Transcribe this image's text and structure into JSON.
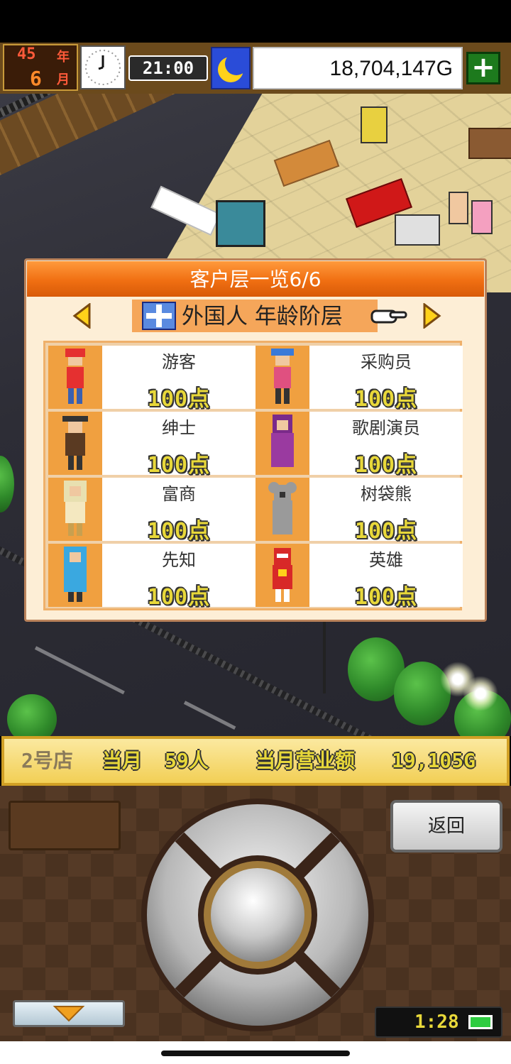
{
  "hud": {
    "year_num": "45",
    "year_unit": "年",
    "month_num": "6",
    "month_unit": "月",
    "time": "21:00",
    "money": "18,704,147G",
    "add_label": "+"
  },
  "dialog": {
    "title": "客户层一览6/6",
    "category": "外国人 年龄阶层",
    "customers": [
      {
        "name": "游客",
        "points": "100点",
        "color": "#e53030"
      },
      {
        "name": "采购员",
        "points": "100点",
        "color": "#3a7ad8"
      },
      {
        "name": "绅士",
        "points": "100点",
        "color": "#5a3a22"
      },
      {
        "name": "歌剧演员",
        "points": "100点",
        "color": "#9a3aa0"
      },
      {
        "name": "富商",
        "points": "100点",
        "color": "#e8e0b0"
      },
      {
        "name": "树袋熊",
        "points": "100点",
        "color": "#9a9a9a"
      },
      {
        "name": "先知",
        "points": "100点",
        "color": "#3aa8e0"
      },
      {
        "name": "英雄",
        "points": "100点",
        "color": "#d82828"
      }
    ]
  },
  "status": {
    "shop": "2号店",
    "month_label": "当月",
    "visitors": "59人",
    "sales_label": "当月营业额",
    "sales": "19,105G"
  },
  "controls": {
    "back_label": "返回",
    "clock_time": "1:28"
  },
  "colors": {
    "accent": "#f06f12",
    "panel_bg": "#fdeed6",
    "points_yellow": "#e8d83a"
  }
}
